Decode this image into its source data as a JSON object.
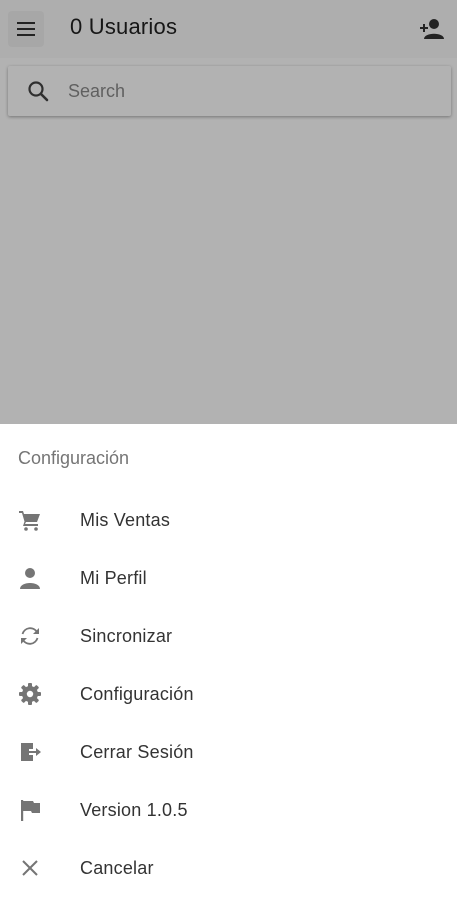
{
  "appbar": {
    "title": "0 Usuarios",
    "menu_icon": "menu-icon",
    "add_user_icon": "person-add-icon"
  },
  "search": {
    "placeholder": "Search",
    "value": "",
    "icon": "search-icon"
  },
  "sheet": {
    "title": "Configuración",
    "items": [
      {
        "label": "Mis Ventas",
        "icon": "cart-icon"
      },
      {
        "label": "Mi Perfil",
        "icon": "person-icon"
      },
      {
        "label": "Sincronizar",
        "icon": "sync-icon"
      },
      {
        "label": "Configuración",
        "icon": "gear-icon"
      },
      {
        "label": "Cerrar Sesión",
        "icon": "logout-icon"
      },
      {
        "label": "Version 1.0.5",
        "icon": "flag-icon"
      },
      {
        "label": "Cancelar",
        "icon": "close-icon"
      }
    ]
  },
  "colors": {
    "icon": "#757575",
    "text": "#333333",
    "subheader": "#757575",
    "scrim": "rgba(0,0,0,0.30)"
  }
}
